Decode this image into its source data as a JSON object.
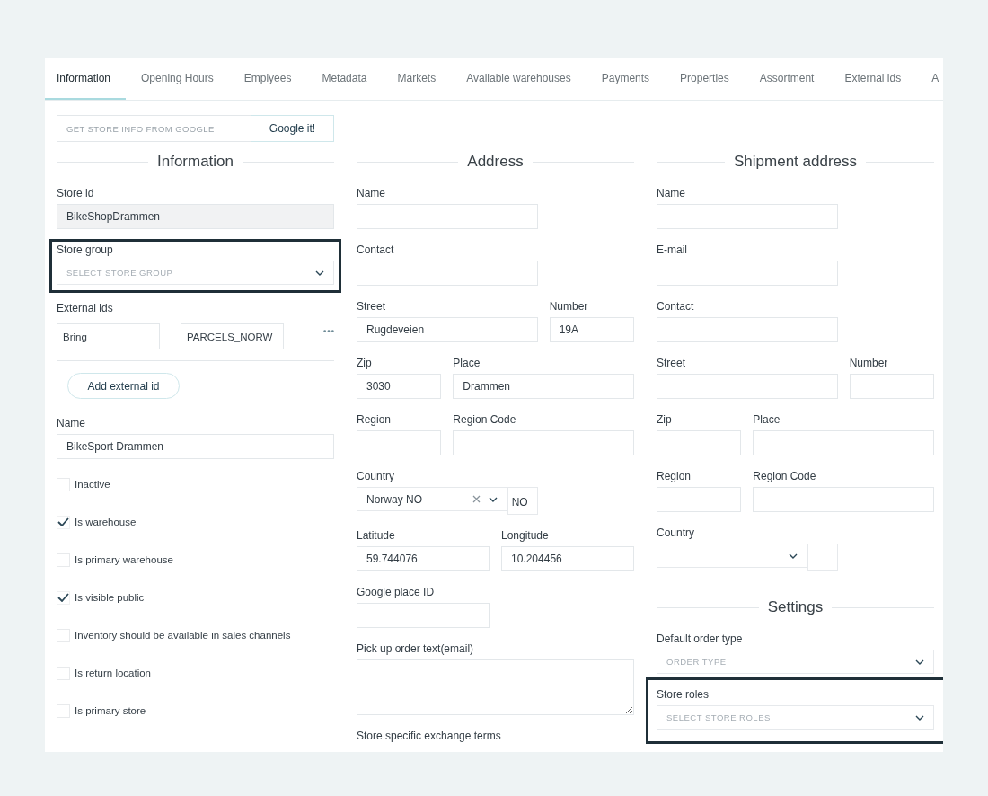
{
  "tabs": [
    {
      "label": "Information",
      "selected": true
    },
    {
      "label": "Opening Hours",
      "selected": false
    },
    {
      "label": "Emplyees",
      "selected": false
    },
    {
      "label": "Metadata",
      "selected": false
    },
    {
      "label": "Markets",
      "selected": false
    },
    {
      "label": "Available warehouses",
      "selected": false
    },
    {
      "label": "Payments",
      "selected": false
    },
    {
      "label": "Properties",
      "selected": false
    },
    {
      "label": "Assortment",
      "selected": false
    },
    {
      "label": "External ids",
      "selected": false
    },
    {
      "label": "A",
      "selected": false
    }
  ],
  "google_lookup": {
    "placeholder": "GET STORE INFO FROM GOOGLE",
    "button": "Google it!"
  },
  "columns": [
    {
      "title": "Information",
      "items": [
        {
          "kind": "fields",
          "highlighted": false,
          "fields": [
            {
              "label": "Store id",
              "kind": "input",
              "value": "BikeShopDrammen",
              "disabled": true
            }
          ]
        },
        {
          "kind": "fields",
          "highlighted": true,
          "fields": [
            {
              "label": "Store group",
              "kind": "select",
              "placeholder": "SELECT STORE GROUP"
            }
          ]
        },
        {
          "kind": "external_ids",
          "label": "External ids",
          "entries": [
            {
              "system": "Bring",
              "value": "PARCELS_NORW"
            }
          ],
          "button": "Add external id"
        },
        {
          "kind": "fields",
          "highlighted": false,
          "fields": [
            {
              "label": "Name",
              "kind": "input",
              "value": "BikeSport Drammen",
              "disabled": false
            }
          ]
        },
        {
          "kind": "checkbox",
          "label": "Inactive",
          "checked": false
        },
        {
          "kind": "checkbox",
          "label": "Is warehouse",
          "checked": true
        },
        {
          "kind": "checkbox",
          "label": "Is primary warehouse",
          "checked": false
        },
        {
          "kind": "checkbox",
          "label": "Is visible public",
          "checked": true
        },
        {
          "kind": "checkbox",
          "label": "Inventory should be available in sales channels",
          "checked": false
        },
        {
          "kind": "checkbox",
          "label": "Is return location",
          "checked": false
        },
        {
          "kind": "checkbox",
          "label": "Is primary store",
          "checked": false
        }
      ]
    },
    {
      "title": "Address",
      "items": [
        {
          "kind": "fields",
          "highlighted": false,
          "fields": [
            {
              "label": "Name",
              "kind": "input"
            }
          ]
        },
        {
          "kind": "fields",
          "highlighted": false,
          "fields": [
            {
              "label": "Contact",
              "kind": "input"
            }
          ]
        },
        {
          "kind": "fields",
          "highlighted": false,
          "fields": [
            {
              "label": "Street",
              "kind": "input",
              "value": "Rugdeveien"
            },
            {
              "label": "Number",
              "kind": "input",
              "value": "19A"
            }
          ]
        },
        {
          "kind": "fields",
          "highlighted": false,
          "fields": [
            {
              "label": "Zip",
              "kind": "input",
              "value": "3030"
            },
            {
              "label": "Place",
              "kind": "input",
              "value": "Drammen"
            }
          ]
        },
        {
          "kind": "fields",
          "highlighted": false,
          "fields": [
            {
              "label": "Region",
              "kind": "input"
            },
            {
              "label": "Region Code",
              "kind": "input"
            }
          ]
        },
        {
          "kind": "fields",
          "highlighted": false,
          "fields": [
            {
              "label": "Country",
              "kind": "country",
              "value": "Norway NO",
              "code": "NO",
              "clearable": true
            }
          ]
        },
        {
          "kind": "fields",
          "highlighted": false,
          "fields": [
            {
              "label": "Latitude",
              "kind": "input",
              "value": "59.744076"
            },
            {
              "label": "Longitude",
              "kind": "input",
              "value": "10.204456"
            }
          ]
        },
        {
          "kind": "fields",
          "highlighted": false,
          "fields": [
            {
              "label": "Google place ID",
              "kind": "input"
            }
          ]
        },
        {
          "kind": "fields",
          "highlighted": false,
          "fields": [
            {
              "label": "Pick up order text(email)",
              "kind": "textarea"
            }
          ]
        },
        {
          "kind": "label",
          "label": "Store specific exchange terms"
        }
      ]
    },
    {
      "title": "Shipment address",
      "items": [
        {
          "kind": "fields",
          "highlighted": false,
          "fields": [
            {
              "label": "Name",
              "kind": "input"
            }
          ]
        },
        {
          "kind": "fields",
          "highlighted": false,
          "fields": [
            {
              "label": "E-mail",
              "kind": "input"
            }
          ]
        },
        {
          "kind": "fields",
          "highlighted": false,
          "fields": [
            {
              "label": "Contact",
              "kind": "input"
            }
          ]
        },
        {
          "kind": "fields",
          "highlighted": false,
          "fields": [
            {
              "label": "Street",
              "kind": "input"
            },
            {
              "label": "Number",
              "kind": "input"
            }
          ]
        },
        {
          "kind": "fields",
          "highlighted": false,
          "fields": [
            {
              "label": "Zip",
              "kind": "input"
            },
            {
              "label": "Place",
              "kind": "input"
            }
          ]
        },
        {
          "kind": "fields",
          "highlighted": false,
          "fields": [
            {
              "label": "Region",
              "kind": "input"
            },
            {
              "label": "Region Code",
              "kind": "input"
            }
          ]
        },
        {
          "kind": "fields",
          "highlighted": false,
          "fields": [
            {
              "label": "Country",
              "kind": "country",
              "clearable": false
            }
          ]
        },
        {
          "kind": "heading",
          "text": "Settings"
        },
        {
          "kind": "fields",
          "highlighted": false,
          "fields": [
            {
              "label": "Default order type",
              "kind": "select",
              "placeholder": "ORDER TYPE"
            }
          ]
        },
        {
          "kind": "fields",
          "highlighted": true,
          "fields": [
            {
              "label": "Store roles",
              "kind": "select",
              "placeholder": "SELECT STORE ROLES"
            }
          ]
        }
      ]
    }
  ]
}
